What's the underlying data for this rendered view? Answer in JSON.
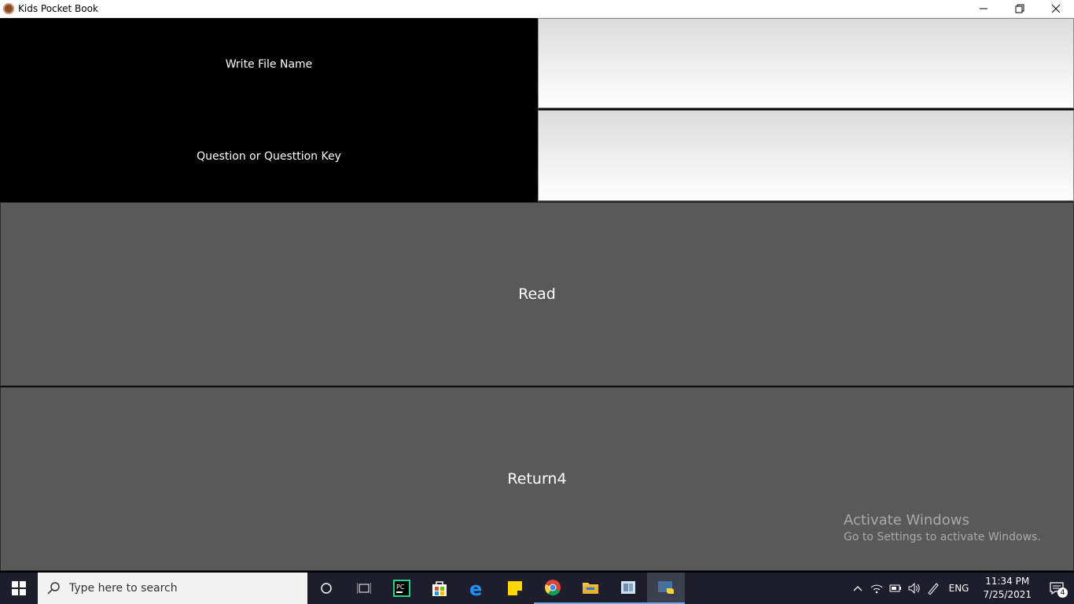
{
  "window": {
    "title": "Kids Pocket Book"
  },
  "form": {
    "file_label": "Write File Name",
    "file_value": "",
    "question_label": "Question or Questtion Key",
    "question_value": ""
  },
  "buttons": {
    "read_label": "Read",
    "return_label": "Return4"
  },
  "watermark": {
    "line1": "Activate Windows",
    "line2": "Go to Settings to activate Windows."
  },
  "taskbar": {
    "search_placeholder": "Type here to search",
    "apps": [
      "cortana-icon",
      "task-view-icon",
      "pycharm-icon",
      "store-icon",
      "edge-icon",
      "sticky-notes-icon",
      "chrome-icon",
      "file-explorer-icon",
      "app-icon",
      "python-icon"
    ],
    "language": "ENG",
    "time": "11:34 PM",
    "date": "7/25/2021",
    "notification_count": "4"
  },
  "colors": {
    "label_bg": "#000000",
    "button_bg": "#595959",
    "taskbar_bg": "#1e1e2a"
  }
}
